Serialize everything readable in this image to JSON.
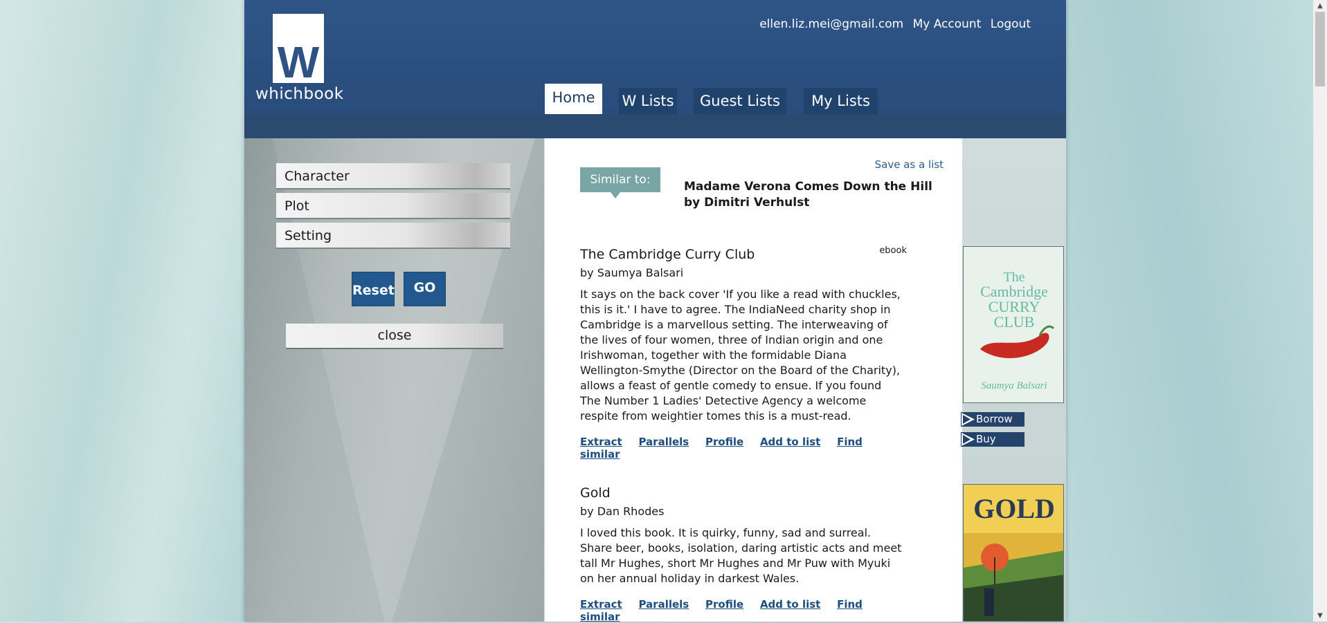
{
  "header": {
    "logo_text": "whichbook",
    "logo_letter": "W",
    "account": {
      "email": "ellen.liz.mei@gmail.com",
      "my_account": "My Account",
      "logout": "Logout"
    },
    "tabs": [
      {
        "label": "Home",
        "active": true
      },
      {
        "label": "W Lists"
      },
      {
        "label": "Guest Lists"
      },
      {
        "label": "My Lists"
      }
    ]
  },
  "sidebar": {
    "facets": [
      "Character",
      "Plot",
      "Setting"
    ],
    "reset_label": "Reset",
    "go_label": "GO",
    "close_label": "close"
  },
  "main": {
    "save_list": "Save as a list",
    "similar_badge": "Similar to:",
    "similar_title": "Madame Verona Comes Down the Hill by Dimitri Verhulst",
    "books": [
      {
        "title": "The Cambridge Curry Club",
        "author": "by Saumya Balsari",
        "format": "ebook",
        "blurb": "It says on the back cover 'If you like a read with chuckles, this is it.' I have to agree. The IndiaNeed charity shop in Cambridge is a marvellous setting. The interweaving of the lives of four women, three of Indian origin and one Irishwoman, together with the formidable Diana Wellington-Smythe (Director on the Board of the Charity), allows a feast of gentle comedy to ensue. If you found The Number 1 Ladies' Detective Agency a welcome respite from weightier tomes this is a must-read.",
        "links": [
          "Extract",
          "Parallels",
          "Profile",
          "Add to list",
          "Find similar"
        ]
      },
      {
        "title": "Gold",
        "author": "by Dan Rhodes",
        "blurb": "I loved this book. It is quirky, funny, sad and surreal. Share beer, books, isolation, daring artistic acts and meet tall Mr Hughes, short Mr Hughes and Mr Puw with Myuki on her annual holiday in darkest Wales.",
        "links": [
          "Extract",
          "Parallels",
          "Profile",
          "Add to list",
          "Find similar"
        ]
      }
    ]
  },
  "covers": {
    "cover1": {
      "title": "The Cambridge CURRY CLUB",
      "author": "Saumya Balsari",
      "bg": "#e8f2ea",
      "title_color": "#66b9a6"
    },
    "cover2": {
      "title": "GOLD",
      "bg": "#e0b43a"
    },
    "actions": [
      "Borrow",
      "Buy"
    ]
  }
}
